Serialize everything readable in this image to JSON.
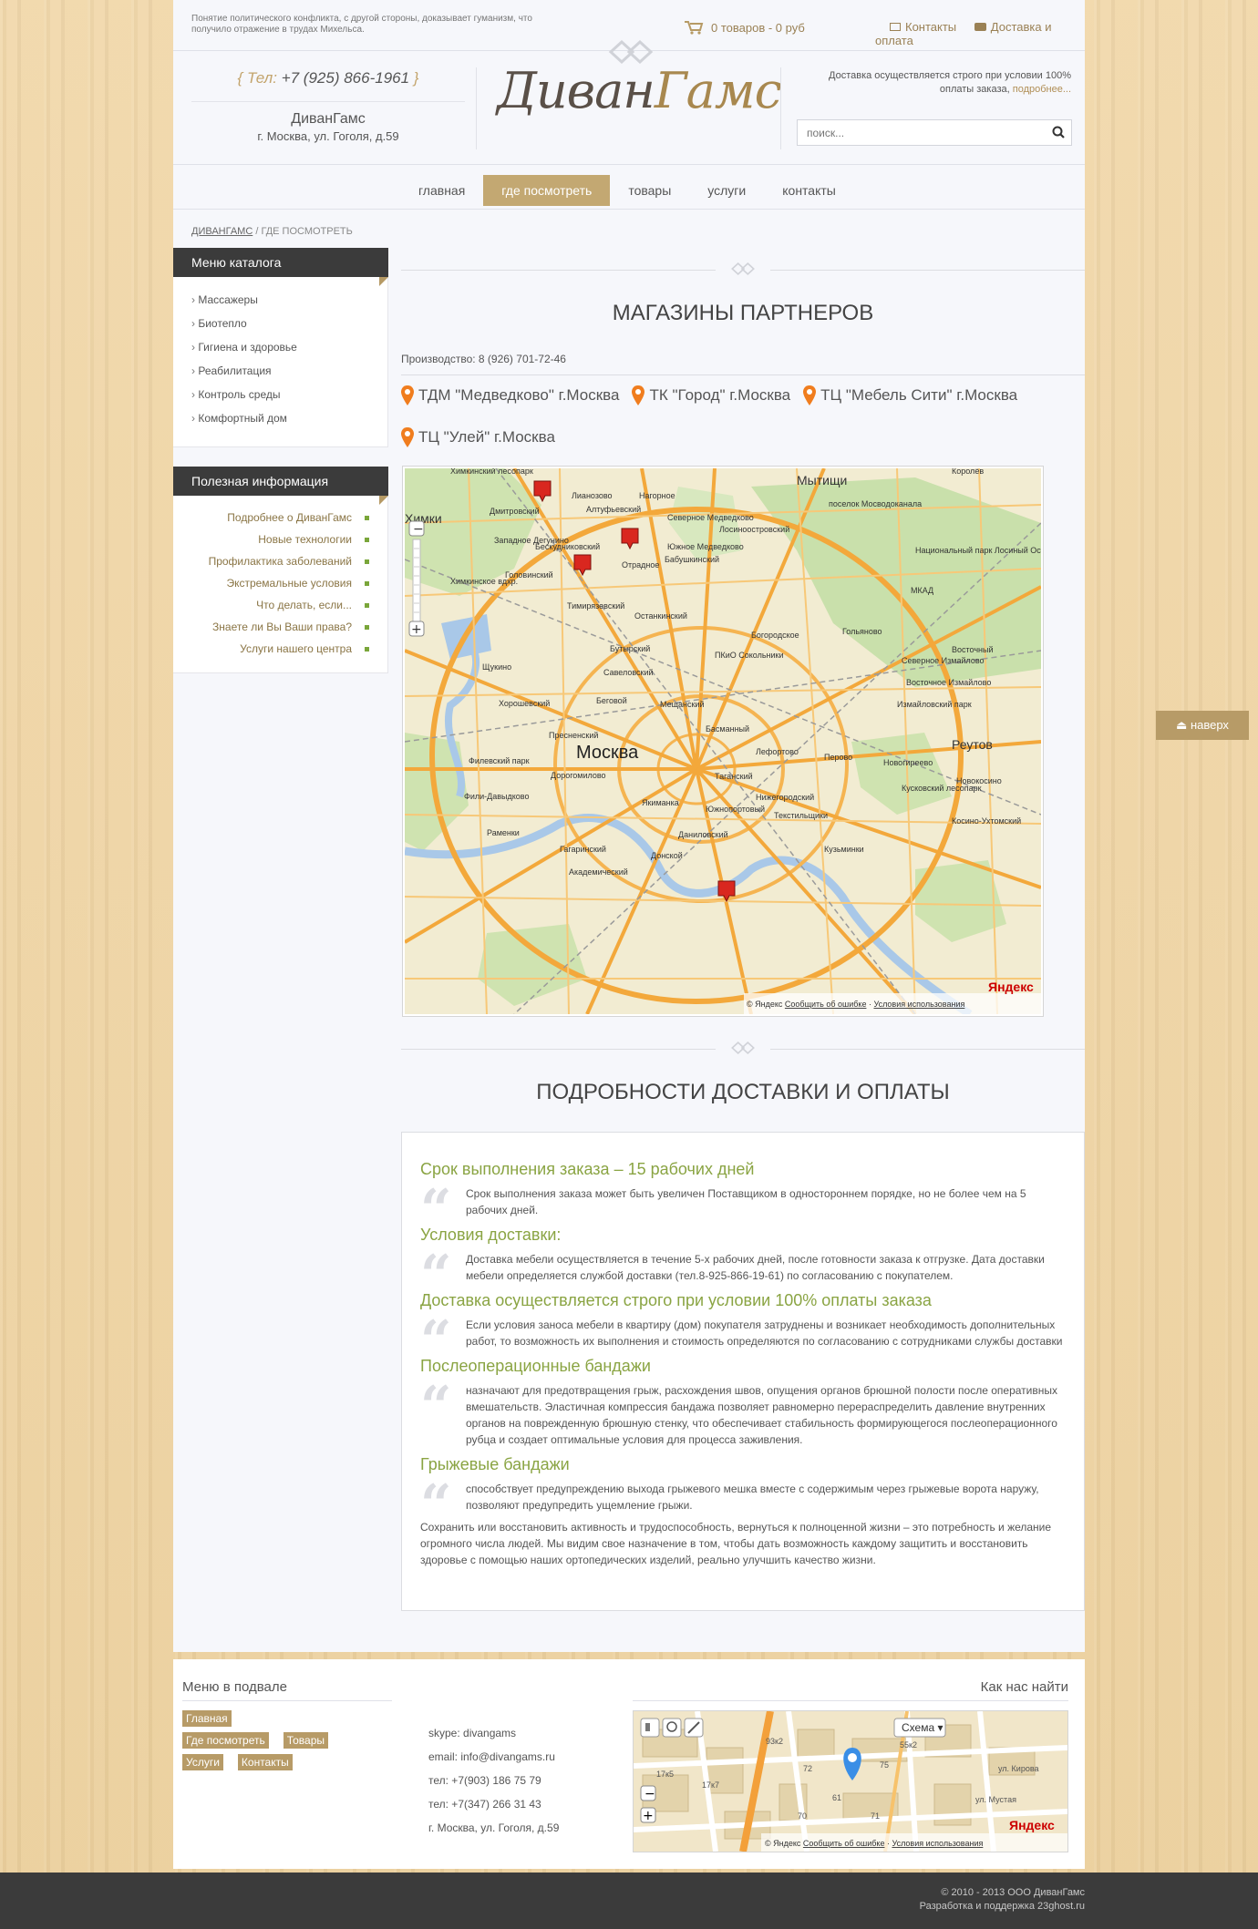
{
  "top": {
    "tagline": "Понятие политического конфликта, с другой стороны, доказывает гуманизм, что получило отражение в трудах Михельса.",
    "cart_text": "0 товаров - 0 руб",
    "links": [
      "Контакты",
      "Доставка и оплата"
    ]
  },
  "header": {
    "phone_prefix": "Тел:",
    "phone": "+7 (925) 866-1961",
    "brand_name": "ДиванГамс",
    "address": "г. Москва, ул. Гоголя, д.59",
    "logo_part1": "Диван",
    "logo_part2": "Гамс",
    "delivery_note": "Доставка осуществляется строго при условии 100% оплаты заказа,",
    "delivery_more": "подробнее...",
    "search_placeholder": "поиск..."
  },
  "nav": {
    "items": [
      "главная",
      "где посмотреть",
      "товары",
      "услуги",
      "контакты"
    ],
    "active_index": 1
  },
  "breadcrumb": {
    "home": "ДИВАНГАМС",
    "separator": "/",
    "current": "ГДЕ ПОСМОТРЕТЬ"
  },
  "catalog": {
    "title": "Меню каталога",
    "items": [
      "Массажеры",
      "Биотепло",
      "Гигиена и здоровье",
      "Реабилитация",
      "Контроль среды",
      "Комфортный дом"
    ]
  },
  "useful": {
    "title": "Полезная информация",
    "items": [
      "Подробнее о ДиванГамс",
      "Новые технологии",
      "Профилактика заболеваний",
      "Экстремальные условия",
      "Что делать, если...",
      "Знаете ли Вы Ваши права?",
      "Услуги нашего центра"
    ]
  },
  "partners": {
    "title": "МАГАЗИНЫ ПАРТНЕРОВ",
    "production": "Производство: 8 (926) 701-72-46",
    "stores": [
      "ТДМ \"Медведково\" г.Москва",
      "ТК \"Город\" г.Москва",
      "ТЦ \"Мебель Сити\" г.Москва",
      "ТЦ \"Улей\" г.Москва"
    ]
  },
  "map": {
    "city_label": "Москва",
    "labels": [
      "Мытищи",
      "Королёв",
      "Химки",
      "Химкинский лесопарк",
      "Лианозово",
      "Нагорное",
      "Дмитровский",
      "Северное Медведково",
      "Южное Медведково",
      "Алтуфьевский",
      "Бескудниковский",
      "Отрадное",
      "Бабушкинский",
      "Лосиноостровский",
      "поселок Мосводоканала",
      "Национальный парк Лосиный Остров",
      "МКАД",
      "Западное Дегунино",
      "Головинский",
      "Химкинское вдхр.",
      "Тимирязевский",
      "Останкинский",
      "Гольяново",
      "Богородское",
      "Северное Измайлово",
      "Восточный",
      "ПКиО Сокольники",
      "Бутырский",
      "Щукино",
      "Савеловский",
      "Восточное Измайлово",
      "Хорошевский",
      "Беговой",
      "Мещанский",
      "Измайловский парк",
      "Пресненский",
      "Басманный",
      "Лефортово",
      "Реутов",
      "Филевский парк",
      "Перово",
      "Новогиреево",
      "Дорогомилово",
      "Таганский",
      "Нижегородский",
      "Кусковский лесопарк",
      "Фили-Давыдково",
      "Якиманка",
      "Текстильщики",
      "Южнопортовый",
      "Раменки",
      "Гагаринский",
      "Даниловский",
      "Донской",
      "Кузьминки",
      "Академический",
      "Новокосино",
      "Косино-Ухтомский"
    ],
    "copyright": "© Яндекс",
    "report": "Сообщить об ошибке",
    "terms": "Условия использования",
    "provider": "Яндекс"
  },
  "delivery": {
    "title": "ПОДРОБНОСТИ ДОСТАВКИ И ОПЛАТЫ",
    "blocks": [
      {
        "heading": "Срок выполнения заказа – 15 рабочих дней",
        "text": "Срок выполнения заказа может быть увеличен Поставщиком в одностороннем порядке, но не более чем на 5 рабочих дней."
      },
      {
        "heading": "Условия доставки:",
        "text": "Доставка мебели осуществляется в течение 5-х рабочих дней, после готовности заказа к отгрузке. Дата доставки мебели определяется службой доставки (тел.8-925-866-19-61) по согласованию с покупателем."
      },
      {
        "heading": "Доставка осуществляется строго при условии 100% оплаты заказа",
        "text": "Если условия заноса мебели в квартиру (дом) покупателя затруднены и возникает необходимость дополнительных работ, то возможность их выполнения и стоимость определяются по согласованию с сотрудниками службы доставки"
      },
      {
        "heading": "Послеоперационные бандажи",
        "text": "назначают для предотвращения грыж, расхождения швов, опущения органов брюшной полости после оперативных вмешательств. Эластичная компрессия бандажа позволяет равномерно перераспределить давление внутренних органов на поврежденную брюшную стенку, что обеспечивает стабильность формирующегося послеоперационного рубца и создает оптимальные условия для процесса заживления."
      },
      {
        "heading": "Грыжевые бандажи",
        "text": "способствует предупреждению выхода грыжевого мешка вместе с содержимым через грыжевые ворота наружу, позволяют предупредить ущемление грыжи."
      }
    ],
    "closing": "Сохранить или восстановить активность и трудоспособность, вернуться к полноценной жизни – это потребность и желание огромного числа людей. Мы видим свое назначение в том, чтобы дать возможность каждому защитить и восстановить здоровье с помощью наших ортопедических изделий, реально улучшить качество жизни."
  },
  "to_top": "наверх",
  "footer": {
    "menu_title": "Меню в подвале",
    "menu_items": [
      "Главная",
      "Где посмотреть",
      "Товары",
      "Услуги",
      "Контакты"
    ],
    "contacts": [
      "skype: divangams",
      "email: info@divangams.ru",
      "тел: +7(903) 186 75 79",
      "тел: +7(347) 266 31 43",
      "г. Москва, ул. Гоголя, д.59"
    ],
    "find_title": "Как нас найти",
    "map_mode": "Схема",
    "map_copyright": "© Яндекс",
    "map_report": "Сообщить об ошибке",
    "map_terms": "Условия использования",
    "map_provider": "Яндекс",
    "street_labels": [
      "ул. Кирова",
      "ул. Мустая",
      "55к2",
      "93к2",
      "17к5",
      "17к7",
      "72",
      "75",
      "61",
      "70",
      "71"
    ],
    "copyright_line1": "© 2010 - 2013 ООО ДиванГамс",
    "copyright_line2": "Разработка и поддержка 23ghost.ru"
  },
  "colors": {
    "accent": "#c3a872",
    "dark": "#3b3b3b",
    "green": "#8aa443",
    "pin": "#f07d1e"
  }
}
